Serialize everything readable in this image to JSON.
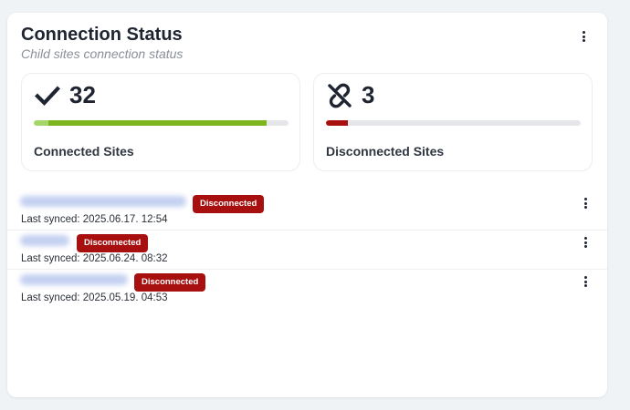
{
  "widget": {
    "title": "Connection Status",
    "subtitle": "Child sites connection status"
  },
  "stats": {
    "connected": {
      "icon": "checkmark-icon",
      "count": "32",
      "label": "Connected Sites",
      "progress_fraction": 0.914,
      "color": "#7cb51d"
    },
    "disconnected": {
      "icon": "broken-link-icon",
      "count": "3",
      "label": "Disconnected Sites",
      "progress_fraction": 0.086,
      "color": "#a80f0f"
    }
  },
  "sites": [
    {
      "status": "Disconnected",
      "last_synced": "Last synced: 2025.06.17. 12:54"
    },
    {
      "status": "Disconnected",
      "last_synced": "Last synced: 2025.06.24. 08:32"
    },
    {
      "status": "Disconnected",
      "last_synced": "Last synced: 2025.05.19. 04:53"
    }
  ],
  "colors": {
    "badge_bg": "#a8100f",
    "card_bg": "#ffffff",
    "page_bg": "#f0f3f6"
  }
}
